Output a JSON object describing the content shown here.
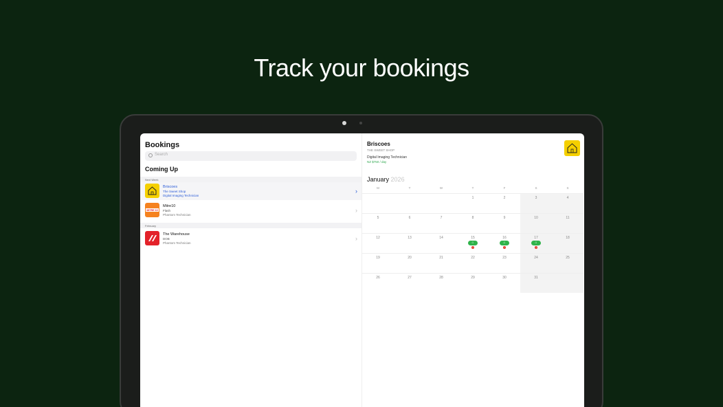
{
  "headline": "Track your bookings",
  "bookings": {
    "title": "Bookings",
    "search_placeholder": "Search",
    "coming_up": "Coming Up",
    "sections": [
      {
        "label": "Next Week"
      },
      {
        "label": "February"
      }
    ],
    "items": [
      {
        "name": "Briscoes",
        "shop": "The Sweet Shop",
        "role": "Digital Imaging Technician",
        "logo_color": "#f5d000",
        "selected": true
      },
      {
        "name": "Mitre10",
        "shop": "Flash",
        "role": "Phantom Technician",
        "logo_color": "#f5821f",
        "logo_text": "MITRE 10"
      },
      {
        "name": "The Warehouse",
        "shop": "DOB",
        "role": "Phantom Technician",
        "logo_color": "#e3222a"
      }
    ]
  },
  "detail": {
    "title": "Briscoes",
    "shop": "THE SWEET SHOP",
    "role": "Digital Imaging Technician",
    "rate": "NZ $750 / day",
    "logo_color": "#f5d000"
  },
  "calendar": {
    "month": "January",
    "year": "2026",
    "weekdays": [
      "M",
      "T",
      "W",
      "T",
      "F",
      "S",
      "S"
    ],
    "weeks": [
      [
        "",
        "",
        "",
        "1",
        "2",
        "3",
        "4"
      ],
      [
        "5",
        "6",
        "7",
        "8",
        "9",
        "10",
        "11"
      ],
      [
        "12",
        "13",
        "14",
        "15",
        "16",
        "17",
        "18"
      ],
      [
        "19",
        "20",
        "21",
        "22",
        "23",
        "24",
        "25"
      ],
      [
        "26",
        "27",
        "28",
        "29",
        "30",
        "31",
        ""
      ]
    ],
    "booked_days": [
      "15",
      "16",
      "17"
    ],
    "accent_color": "#2fb34a",
    "alert_color": "#e23b2e"
  }
}
